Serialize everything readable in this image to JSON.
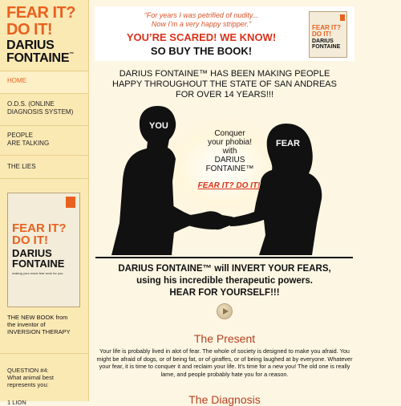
{
  "logo": {
    "line1": "FEAR IT?",
    "line2": "DO IT!",
    "line3": "DARIUS",
    "line4": "FONTAINE",
    "tm": "™"
  },
  "nav": {
    "home": "HOME",
    "ods": [
      "O.D.S. (ONLINE",
      "DIAGNOSIS SYSTEM)"
    ],
    "people": [
      "PEOPLE",
      "ARE TALKING"
    ],
    "lies": "THE LIES"
  },
  "sidebar_book": {
    "line1": "FEAR IT?",
    "line2": "DO IT!",
    "line3": "DARIUS",
    "line4": "FONTAINE",
    "tagline": "making your worst fear work for you."
  },
  "newbook": [
    "THE NEW BOOK from",
    "the inventor of",
    "INVERSION THERAPY"
  ],
  "quiz": {
    "question": [
      "QUESTION #4:",
      "What animal best",
      "represents you:"
    ],
    "option1": "1 LION"
  },
  "banner": {
    "quote": [
      "“For years I was petrified of nudity...",
      "Now I’m a very happy stripper.”"
    ],
    "scared": "YOU’RE SCARED!  WE KNOW!",
    "buy": "SO BUY THE BOOK!",
    "book": {
      "line1": "FEAR IT?",
      "line2": "DO IT!",
      "line3": "DARIUS",
      "line4": "FONTAINE"
    }
  },
  "intro": [
    "DARIUS FONTAINE™ HAS BEEN MAKING PEOPLE",
    "HAPPY THROUGHOUT THE STATE OF SAN ANDREAS",
    "FOR OVER 14 YEARS!!!"
  ],
  "hero": {
    "you": "YOU",
    "fear": "FEAR",
    "conquer": [
      "Conquer",
      "your phobia!",
      "with",
      "DARIUS",
      "FONTAINE™"
    ],
    "brand": "FEAR IT? DO IT!"
  },
  "invert": [
    "DARIUS FONTAINE™ will INVERT YOUR FEARS,",
    "using his incredible therapeutic powers.",
    "HEAR FOR YOURSELF!!!"
  ],
  "present": {
    "title": "The Present",
    "body": "Your life is probably lived in alot of fear. The whole of society is designed to make you afraid. You might be afraid of dogs, or of being fat, or of giraffes, or of being laughed at by everyone. Whatever your fear, it is time to conquer it and reclaim your life. It's time for a new you! The old one is really lame, and people probably hate you for a reason."
  },
  "diagnosis_title": "The Diagnosis",
  "colors": {
    "accent": "#e8611f",
    "heading": "#b5401f",
    "sidebar": "#fbe9b4",
    "page": "#fdf6e3"
  }
}
